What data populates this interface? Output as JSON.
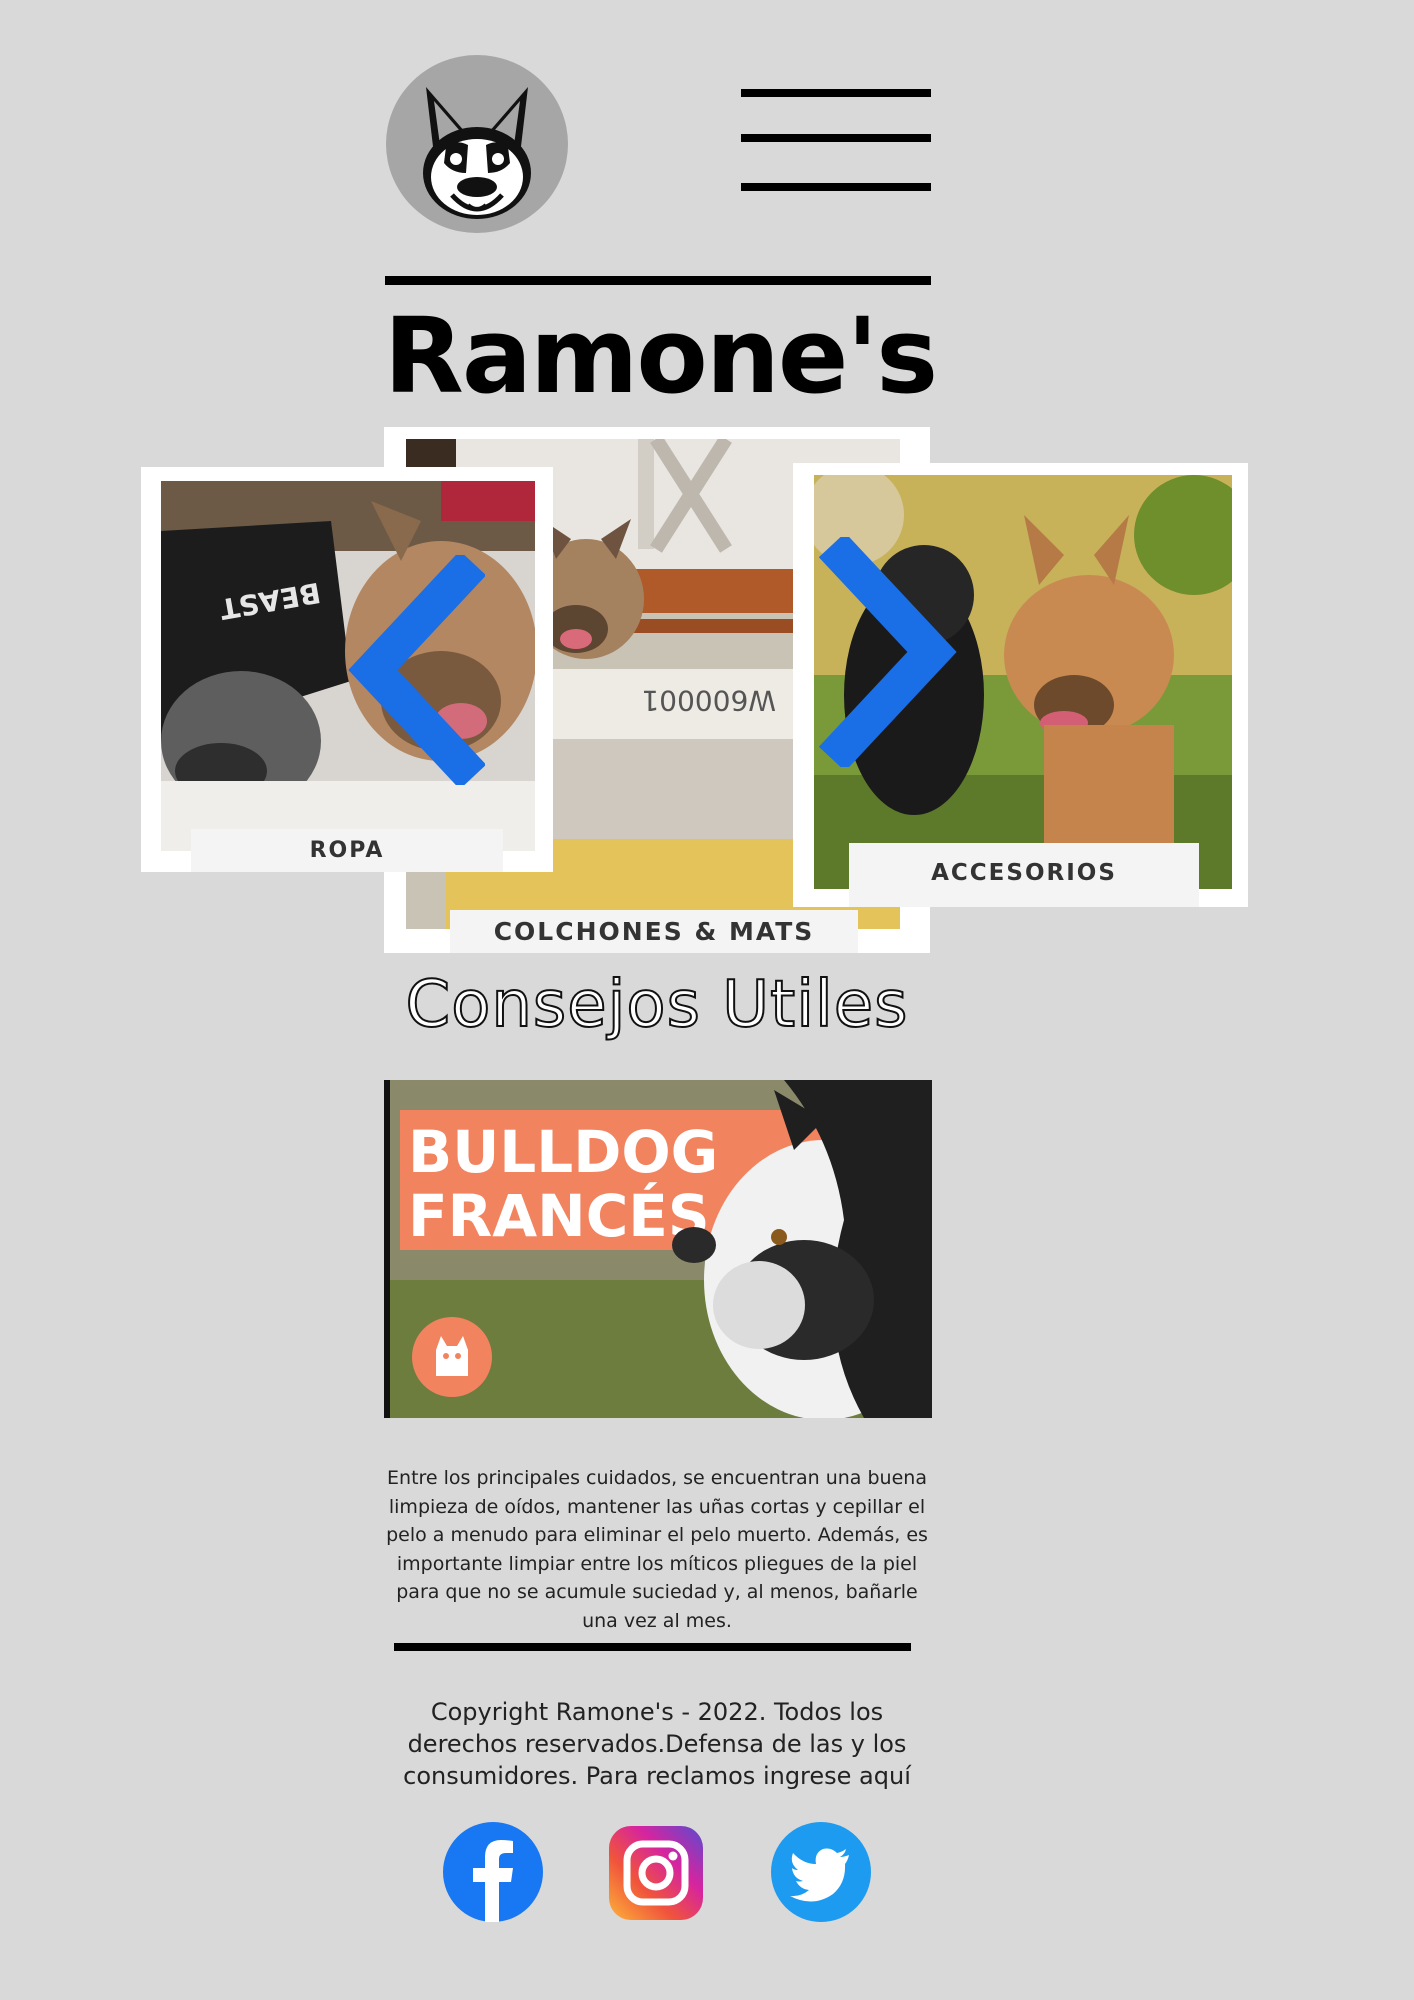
{
  "header": {
    "logo_icon": "french-bulldog-head-icon",
    "menu_icon": "hamburger-menu-icon",
    "brand": "Ramone's"
  },
  "carousel": {
    "prev_icon": "chevron-left-icon",
    "next_icon": "chevron-right-icon",
    "arrow_color": "#1a6ee6",
    "slides": [
      {
        "label": "ROPA"
      },
      {
        "label": "COLCHONES & MATS"
      },
      {
        "label": "ACCESORIOS"
      }
    ],
    "center_sign_text": "W600001"
  },
  "tips": {
    "title": "Consejos Utiles",
    "video": {
      "line1": "BULLDOG",
      "line2": "FRANCÉS",
      "banner_color": "#f2835f",
      "badge_icon": "cat-icon"
    },
    "text": "Entre los principales cuidados, se encuentran una buena limpieza de oídos, mantener las uñas cortas y cepillar el pelo a menudo para eliminar el pelo muerto. Además, es importante limpiar entre los míticos pliegues de la piel para que no se acumule suciedad y, al menos, bañarle una vez al mes."
  },
  "footer": {
    "copyright": "Copyright Ramone's - 2022. Todos los derechos reservados.Defensa de las y los consumidores. Para reclamos ingrese aquí",
    "social": [
      {
        "name": "facebook-icon",
        "color": "#1877f2"
      },
      {
        "name": "instagram-icon",
        "color": "#d6249f"
      },
      {
        "name": "twitter-icon",
        "color": "#1d9bf0"
      }
    ]
  }
}
